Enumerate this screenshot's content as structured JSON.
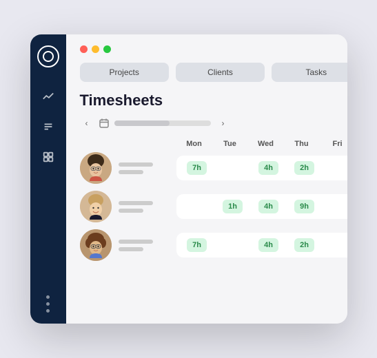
{
  "window": {
    "controls": {
      "close": "close",
      "minimize": "minimize",
      "maximize": "maximize"
    }
  },
  "tabs": [
    {
      "label": "Projects",
      "active": false
    },
    {
      "label": "Clients",
      "active": false
    },
    {
      "label": "Tasks",
      "active": false
    }
  ],
  "page": {
    "title": "Timesheets"
  },
  "calendar": {
    "prev_label": "‹",
    "next_label": "›"
  },
  "days": [
    "Mon",
    "Tue",
    "Wed",
    "Thu",
    "Fri"
  ],
  "rows": [
    {
      "hours": [
        {
          "day": "Mon",
          "value": "7h",
          "filled": true
        },
        {
          "day": "Tue",
          "value": "",
          "filled": false
        },
        {
          "day": "Wed",
          "value": "4h",
          "filled": true
        },
        {
          "day": "Thu",
          "value": "2h",
          "filled": true
        },
        {
          "day": "Fri",
          "value": "",
          "filled": false
        }
      ]
    },
    {
      "hours": [
        {
          "day": "Mon",
          "value": "",
          "filled": false
        },
        {
          "day": "Tue",
          "value": "1h",
          "filled": true
        },
        {
          "day": "Wed",
          "value": "4h",
          "filled": true
        },
        {
          "day": "Thu",
          "value": "9h",
          "filled": true
        },
        {
          "day": "Fri",
          "value": "",
          "filled": false
        }
      ]
    },
    {
      "hours": [
        {
          "day": "Mon",
          "value": "7h",
          "filled": true
        },
        {
          "day": "Tue",
          "value": "",
          "filled": false
        },
        {
          "day": "Wed",
          "value": "4h",
          "filled": true
        },
        {
          "day": "Thu",
          "value": "2h",
          "filled": true
        },
        {
          "day": "Fri",
          "value": "",
          "filled": false
        }
      ]
    }
  ],
  "sidebar": {
    "logo": "O",
    "icons": [
      "chart-icon",
      "list-icon",
      "grid-icon"
    ],
    "dots": 3
  }
}
